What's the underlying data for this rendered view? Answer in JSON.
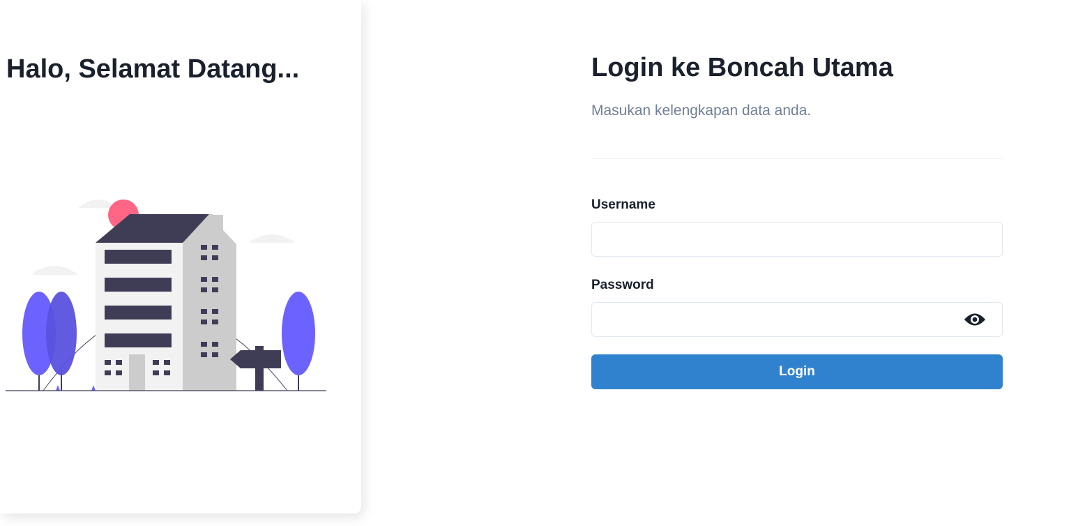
{
  "welcome": {
    "title": "Halo, Selamat Datang..."
  },
  "illustration": {
    "icon": "building-illustration",
    "colors": {
      "building_dark": "#3f3d56",
      "building_light": "#f2f2f2",
      "building_gray": "#cccccc",
      "tree": "#6c63ff",
      "sun": "#ff6584"
    }
  },
  "login": {
    "title": "Login ke Boncah Utama",
    "subtitle": "Masukan kelengkapan data anda.",
    "username_label": "Username",
    "username_value": "",
    "password_label": "Password",
    "password_value": "",
    "password_toggle_icon": "eye-icon",
    "submit_label": "Login"
  },
  "colors": {
    "primary": "#3182ce",
    "heading": "#1a202c",
    "muted": "#718096"
  }
}
